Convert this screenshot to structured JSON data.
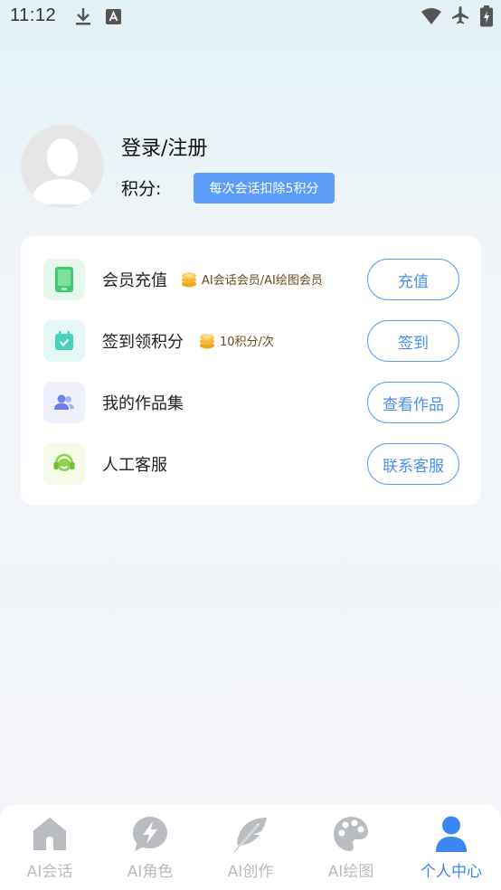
{
  "status_bar": {
    "time": "11:12"
  },
  "profile": {
    "login_title": "登录/注册",
    "points_label": "积分:",
    "points_badge": "每次会话扣除5积分"
  },
  "menu": [
    {
      "label": "会员充值",
      "note": "AI会话会员/AI绘图会员",
      "button": "充值",
      "icon": "phone-icon",
      "icon_color": "#3fcb6e"
    },
    {
      "label": "签到领积分",
      "note": "10积分/次",
      "button": "签到",
      "icon": "calendar-icon",
      "icon_color": "#45d3b9"
    },
    {
      "label": "我的作品集",
      "note": "",
      "button": "查看作品",
      "icon": "users-icon",
      "icon_color": "#6d7ff0"
    },
    {
      "label": "人工客服",
      "note": "",
      "button": "联系客服",
      "icon": "headset-icon",
      "icon_color": "#8fd14a"
    }
  ],
  "tabs": [
    {
      "label": "AI会话",
      "icon": "home-icon",
      "active": false
    },
    {
      "label": "AI角色",
      "icon": "bolt-chat-icon",
      "active": false
    },
    {
      "label": "AI创作",
      "icon": "feather-icon",
      "active": false
    },
    {
      "label": "AI绘图",
      "icon": "palette-icon",
      "active": false
    },
    {
      "label": "个人中心",
      "icon": "person-icon",
      "active": true
    }
  ],
  "colors": {
    "accent": "#5b9df7",
    "active_tab": "#3b86f0",
    "inactive_tab": "#b9bcc0"
  }
}
